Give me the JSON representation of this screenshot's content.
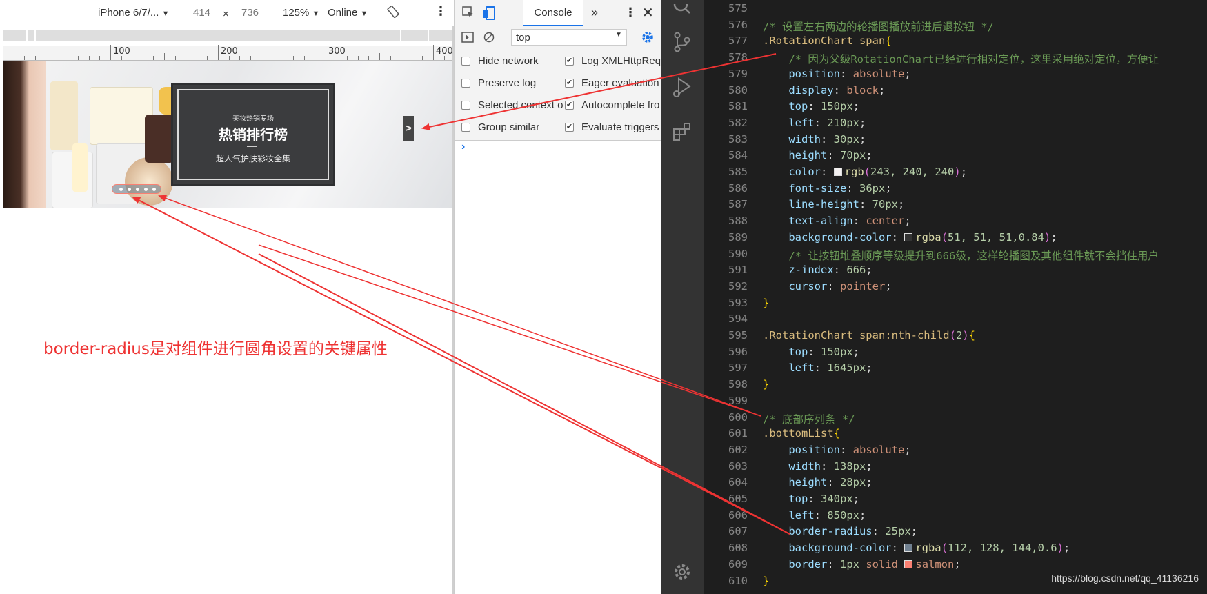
{
  "device_toolbar": {
    "device": "iPhone 6/7/...",
    "width": "414",
    "times": "×",
    "height": "736",
    "zoom": "125%",
    "network": "Online"
  },
  "ruler": {
    "labels": [
      "100",
      "200",
      "300",
      "400"
    ]
  },
  "banner": {
    "promo_small": "美妆热销专场",
    "promo_title": "热销排行榜",
    "promo_sub": "超人气护肤彩妆全集",
    "next_label": ">"
  },
  "annotation": "border-radius是对组件进行圆角设置的关键属性",
  "devtools": {
    "tab_console": "Console",
    "more_tabs": "»",
    "filter_context": "top",
    "options": [
      {
        "label": "Hide network",
        "checked": false
      },
      {
        "label": "Log XMLHttpRequ",
        "checked": true
      },
      {
        "label": "Preserve log",
        "checked": false
      },
      {
        "label": "Eager evaluation",
        "checked": true
      },
      {
        "label": "Selected context o",
        "checked": false
      },
      {
        "label": "Autocomplete fro",
        "checked": true
      },
      {
        "label": "Group similar",
        "checked": false
      },
      {
        "label": "Evaluate triggers u",
        "checked": true
      }
    ],
    "prompt": "›"
  },
  "editor": {
    "line_numbers": [
      "575",
      "576",
      "577",
      "578",
      "579",
      "580",
      "581",
      "582",
      "583",
      "584",
      "585",
      "586",
      "587",
      "588",
      "589",
      "590",
      "591",
      "592",
      "593",
      "594",
      "595",
      "596",
      "597",
      "598",
      "599",
      "600",
      "601",
      "602",
      "603",
      "604",
      "605",
      "606",
      "607",
      "608",
      "609",
      "610"
    ],
    "lines": {
      "l576": "/* 设置左右两边的轮播图播放前进后退按钮 */",
      "l577_sel": ".RotationChart span",
      "l578": "/* 因为父级RotationChart已经进行相对定位，这里采用绝对定位，方便让",
      "l579_p": "position",
      "l579_v": "absolute",
      "l580_p": "display",
      "l580_v": "block",
      "l581_p": "top",
      "l581_v": "150px",
      "l582_p": "left",
      "l582_v": "210px",
      "l583_p": "width",
      "l583_v": "30px",
      "l584_p": "height",
      "l584_v": "70px",
      "l585_p": "color",
      "l585_fn": "rgb",
      "l585_args": "243, 240, 240",
      "l586_p": "font-size",
      "l586_v": "36px",
      "l587_p": "line-height",
      "l587_v": "70px",
      "l588_p": "text-align",
      "l588_v": "center",
      "l589_p": "background-color",
      "l589_fn": "rgba",
      "l589_args": "51, 51, 51,0.84",
      "l590": "/* 让按钮堆叠顺序等级提升到666级，这样轮播图及其他组件就不会挡住用户",
      "l591_p": "z-index",
      "l591_v": "666",
      "l592_p": "cursor",
      "l592_v": "pointer",
      "l595_sel": ".RotationChart span:nth-child",
      "l595_arg": "2",
      "l596_p": "top",
      "l596_v": "150px",
      "l597_p": "left",
      "l597_v": "1645px",
      "l600": "/* 底部序列条 */",
      "l601_sel": ".bottomList",
      "l602_p": "position",
      "l602_v": "absolute",
      "l603_p": "width",
      "l603_v": "138px",
      "l604_p": "height",
      "l604_v": "28px",
      "l605_p": "top",
      "l605_v": "340px",
      "l606_p": "left",
      "l606_v": "850px",
      "l607_p": "border-radius",
      "l607_v": "25px",
      "l608_p": "background-color",
      "l608_fn": "rgba",
      "l608_args": "112, 128, 144,0.6",
      "l609_p": "border",
      "l609_v1": "1px",
      "l609_v2": "solid",
      "l609_v3": "salmon"
    },
    "swatches": {
      "l585": "#f3f0f0",
      "l589": "#333333",
      "l608": "#708090",
      "l609": "#fa8072"
    }
  },
  "watermark": "https://blog.csdn.net/qq_41136216",
  "colors": {
    "accent": "#1a73e8",
    "annotation": "#ee3333",
    "editor_bg": "#1e1e1e"
  }
}
